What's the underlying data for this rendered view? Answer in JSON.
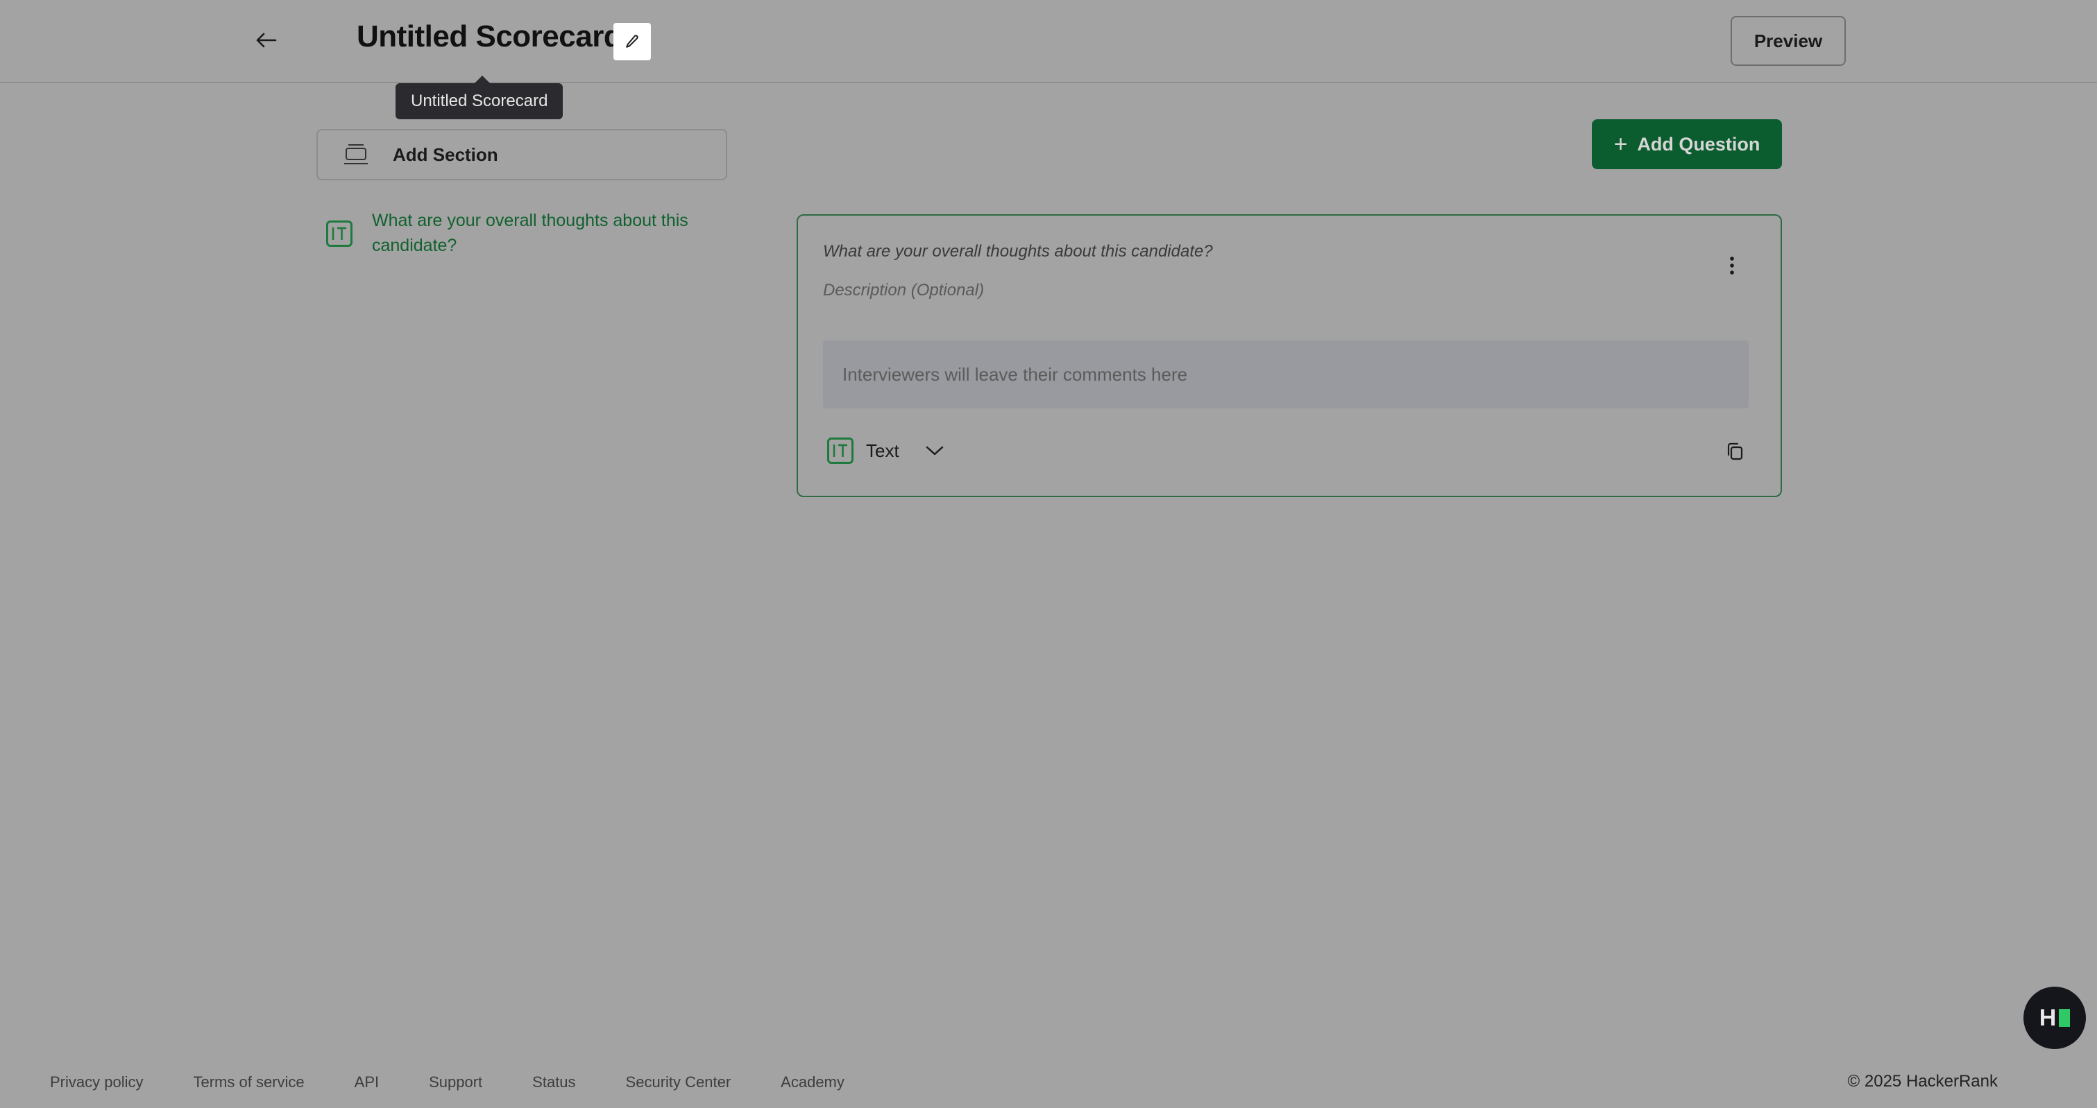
{
  "header": {
    "title": "Untitled Scorecard",
    "tooltip": "Untitled Scorecard",
    "preview_label": "Preview"
  },
  "toolbar": {
    "add_section_label": "Add Section",
    "add_question_label": "Add Question"
  },
  "question_list": [
    {
      "label": "What are your overall thoughts about this candidate?",
      "type": "Text"
    }
  ],
  "editor": {
    "question_placeholder": "What are your overall thoughts about this candidate?",
    "description_placeholder": "Description (Optional)",
    "comment_placeholder": "Interviewers will leave their comments here",
    "type_label": "Text"
  },
  "footer": {
    "links": [
      "Privacy policy",
      "Terms of service",
      "API",
      "Support",
      "Status",
      "Security Center",
      "Academy"
    ],
    "copyright": "© 2025 HackerRank"
  },
  "icons": {
    "back": "arrow-left-icon",
    "edit": "pencil-icon",
    "section": "section-icon",
    "add": "plus-icon",
    "text_type": "text-type-icon",
    "more": "kebab-menu-icon",
    "dropdown": "chevron-down-icon",
    "copy": "copy-icon",
    "brand": "hackerrank-logo-icon"
  },
  "colors": {
    "accent": "#0b5c2e",
    "accent_text": "#11612e",
    "tooltip_bg": "#2b2b2f"
  }
}
